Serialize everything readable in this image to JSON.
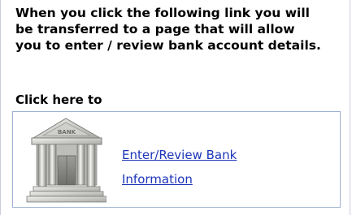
{
  "intro_text": "When you click the following link you will be transferred to a page that will allow you to enter / review bank account details.",
  "click_here_label": "Click here to",
  "bank_link": {
    "label": "Enter/Review Bank Information"
  },
  "icon": {
    "name": "bank-building-icon",
    "sign_text": "BANK"
  },
  "colors": {
    "link": "#1d35b8",
    "box_border": "#9fb2d3",
    "panel_border": "#c9cfd8"
  }
}
